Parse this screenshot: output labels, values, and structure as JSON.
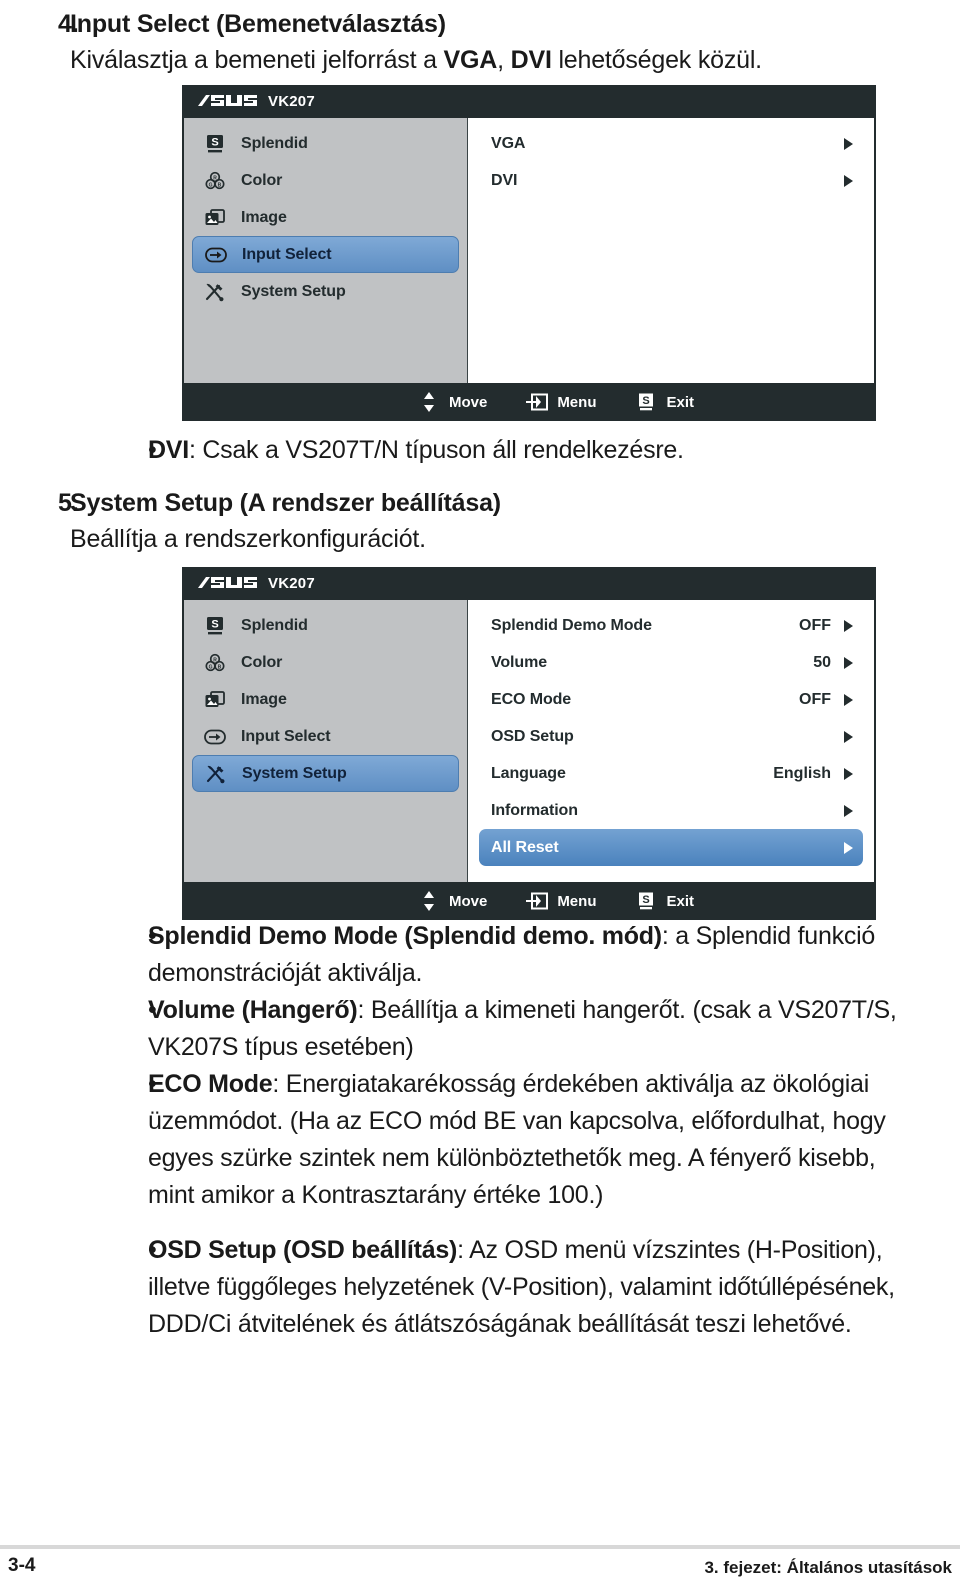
{
  "page": {
    "number": "3-4",
    "chapter": "3. fejezet: Általános utasítások"
  },
  "sections": [
    {
      "num": "4.",
      "head": "Input Select (Bemenetválasztás)",
      "sub_pre": "Kiválasztja a bemeneti jelforrást a ",
      "sub_b1": "VGA",
      "sub_mid": ", ",
      "sub_b2": "DVI",
      "sub_post": " lehetőségek közül."
    },
    {
      "num": "5.",
      "head": "System Setup (A rendszer beállítása)",
      "sub": "Beállítja a rendszerkonfigurációt."
    }
  ],
  "bullets": {
    "dvi": {
      "dot": "•",
      "bold": "DVI",
      "rest": ": Csak a VS207T/N típuson áll rendelkezésre."
    },
    "splendid_demo": {
      "dot": "•",
      "bold": "Splendid Demo Mode (Splendid demo. mód)",
      "rest": ": a Splendid funkció demonstrációját aktiválja."
    },
    "volume": {
      "dot": "•",
      "bold": "Volume (Hangerő)",
      "rest": ": Beállítja a kimeneti hangerőt. (csak a VS207T/S, VK207S típus esetében)"
    },
    "eco": {
      "dot": "•",
      "bold": "ECO Mode",
      "rest": ": Energiatakarékosság érdekében aktiválja az ökológiai üzemmódot. (Ha az ECO mód BE van kapcsolva, előfordulhat, hogy egyes szürke szintek nem különböztethetők meg. A fényerő kisebb, mint amikor a Kontrasztarány értéke 100.)"
    },
    "osd_setup": {
      "dot": "•",
      "bold": "OSD Setup (OSD beállítás)",
      "rest": ": Az OSD menü vízszintes (H-Position), illetve függőleges helyzetének (V-Position), valamint időtúllépésének, DDD/Ci átvitelének és átlátszóságának beállítását teszi lehetővé."
    }
  },
  "osd_colors": {
    "title_bar": "#232c2e",
    "sidebar": "#c0c2c4",
    "content": "#ffffff",
    "highlight_sidebar": "#6f9dd0",
    "highlight_option": "#5e92c9",
    "text": "#232c2e"
  },
  "osd1": {
    "brand": "ASUS",
    "model": "VK207",
    "sidebar": [
      {
        "label": "Splendid",
        "icon": "splendid-icon",
        "selected": false
      },
      {
        "label": "Color",
        "icon": "color-icon",
        "selected": false
      },
      {
        "label": "Image",
        "icon": "image-icon",
        "selected": false
      },
      {
        "label": "Input Select",
        "icon": "input-select-icon",
        "selected": true
      },
      {
        "label": "System Setup",
        "icon": "system-setup-icon",
        "selected": false
      }
    ],
    "options": [
      {
        "label": "VGA",
        "value": "",
        "selected": false
      },
      {
        "label": "DVI",
        "value": "",
        "selected": false
      }
    ],
    "footer": [
      {
        "label": "Move",
        "icon": "updown-arrows-icon"
      },
      {
        "label": "Menu",
        "icon": "enter-menu-icon"
      },
      {
        "label": "Exit",
        "icon": "splendid-s-icon"
      }
    ]
  },
  "osd2": {
    "brand": "ASUS",
    "model": "VK207",
    "sidebar": [
      {
        "label": "Splendid",
        "icon": "splendid-icon",
        "selected": false
      },
      {
        "label": "Color",
        "icon": "color-icon",
        "selected": false
      },
      {
        "label": "Image",
        "icon": "image-icon",
        "selected": false
      },
      {
        "label": "Input Select",
        "icon": "input-select-icon",
        "selected": false
      },
      {
        "label": "System Setup",
        "icon": "system-setup-icon",
        "selected": true
      }
    ],
    "options": [
      {
        "label": "Splendid Demo Mode",
        "value": "OFF",
        "selected": false
      },
      {
        "label": "Volume",
        "value": "50",
        "selected": false
      },
      {
        "label": "ECO Mode",
        "value": "OFF",
        "selected": false
      },
      {
        "label": "OSD Setup",
        "value": "",
        "selected": false
      },
      {
        "label": "Language",
        "value": "English",
        "selected": false
      },
      {
        "label": "Information",
        "value": "",
        "selected": false
      },
      {
        "label": "All Reset",
        "value": "",
        "selected": true
      }
    ],
    "footer": [
      {
        "label": "Move",
        "icon": "updown-arrows-icon"
      },
      {
        "label": "Menu",
        "icon": "enter-menu-icon"
      },
      {
        "label": "Exit",
        "icon": "splendid-s-icon"
      }
    ]
  }
}
